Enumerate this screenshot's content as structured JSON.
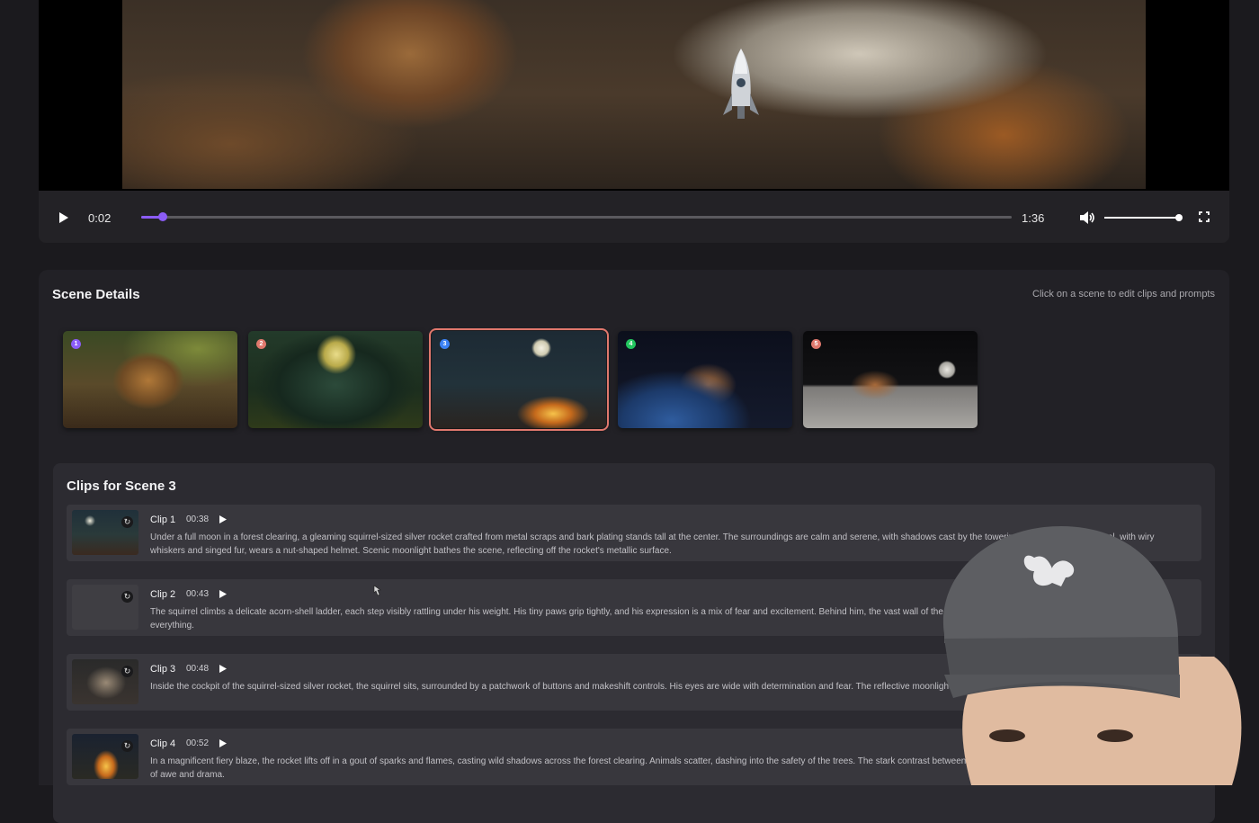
{
  "player": {
    "current_time": "0:02",
    "total_time": "1:36",
    "progress": 0.025,
    "volume": 0.98,
    "accent_color": "#8b5cf6"
  },
  "scenes": {
    "title": "Scene Details",
    "hint": "Click on a scene to edit clips and prompts",
    "items": [
      {
        "number": "1",
        "badge_color": "#8b5cf6",
        "selected": false
      },
      {
        "number": "2",
        "badge_color": "#e0786d",
        "selected": false
      },
      {
        "number": "3",
        "badge_color": "#3b82f6",
        "selected": true
      },
      {
        "number": "4",
        "badge_color": "#22c55e",
        "selected": false
      },
      {
        "number": "5",
        "badge_color": "#e0786d",
        "selected": false
      }
    ]
  },
  "clips": {
    "title": "Clips for Scene 3",
    "items": [
      {
        "label": "Clip 1",
        "duration": "00:38",
        "text": "Under a full moon in a forest clearing, a gleaming squirrel-sized silver rocket crafted from metal scraps and bark plating stands tall at the center. The surroundings are calm and serene, with shadows cast by the towering trees. A curious squirrel, with wiry whiskers and singed fur, wears a nut-shaped helmet. Scenic moonlight bathes the scene, reflecting off the rocket's metallic surface."
      },
      {
        "label": "Clip 2",
        "duration": "00:43",
        "text": "The squirrel climbs a delicate acorn-shell ladder, each step visibly rattling under his weight. His tiny paws grip tightly, and his expression is a mix of fear and excitement. Behind him, the vast wall of the forest looms while the moon casts a silvery glow on everything."
      },
      {
        "label": "Clip 3",
        "duration": "00:48",
        "text": "Inside the cockpit of the squirrel-sized silver rocket, the squirrel sits, surrounded by a patchwork of buttons and makeshift controls. His eyes are wide with determination and fear. The reflective moonlight highlights his determination and the risk of his adventure."
      },
      {
        "label": "Clip 4",
        "duration": "00:52",
        "text": "In a magnificent fiery blaze, the rocket lifts off in a gout of sparks and flames, casting wild shadows across the forest clearing. Animals scatter, dashing into the safety of the trees. The stark contrast between the fiery rocket and the moonlit forest creates a scene of awe and drama."
      }
    ]
  },
  "icons": {
    "play": "play-icon",
    "volume": "volume-icon",
    "fullscreen": "fullscreen-icon",
    "refresh": "refresh-icon"
  }
}
